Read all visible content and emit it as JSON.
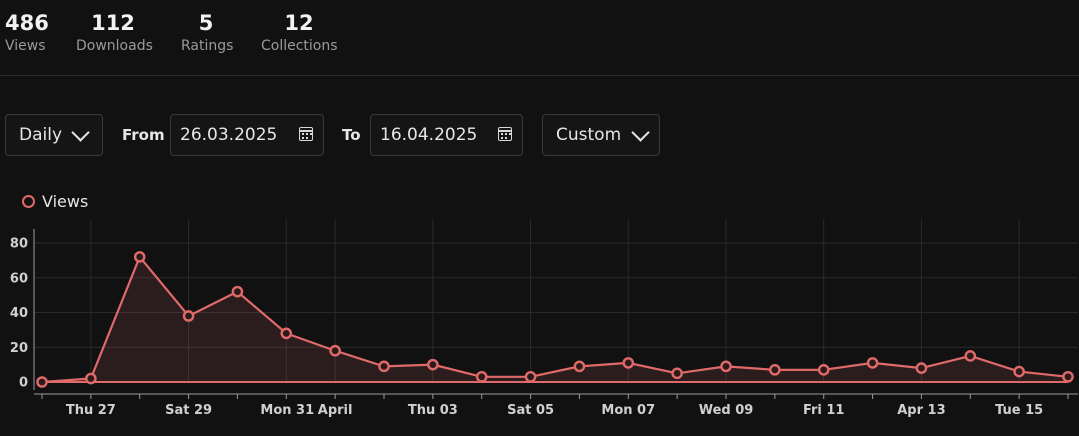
{
  "stats": [
    {
      "value": "486",
      "label": "Views"
    },
    {
      "value": "112",
      "label": "Downloads"
    },
    {
      "value": "5",
      "label": "Ratings"
    },
    {
      "value": "12",
      "label": "Collections"
    }
  ],
  "controls": {
    "interval": "Daily",
    "from_label": "From",
    "from_value": "26.03.2025",
    "to_label": "To",
    "to_value": "16.04.2025",
    "range": "Custom"
  },
  "icons": {
    "dropdown": "chevron-down-icon",
    "date": "calendar-icon",
    "legend": "circle-marker-icon"
  },
  "colors": {
    "series": "#e06a6a",
    "background": "#111112",
    "grid": "#2a2a2a"
  },
  "chart_data": {
    "type": "line",
    "legend": "top-left",
    "grid": true,
    "x": [
      "2025-03-26",
      "2025-03-27",
      "2025-03-28",
      "2025-03-29",
      "2025-03-30",
      "2025-03-31",
      "2025-04-01",
      "2025-04-02",
      "2025-04-03",
      "2025-04-04",
      "2025-04-05",
      "2025-04-06",
      "2025-04-07",
      "2025-04-08",
      "2025-04-09",
      "2025-04-10",
      "2025-04-11",
      "2025-04-12",
      "2025-04-13",
      "2025-04-14",
      "2025-04-15",
      "2025-04-16"
    ],
    "series": [
      {
        "name": "Views",
        "values": [
          0,
          2,
          72,
          38,
          52,
          28,
          18,
          9,
          10,
          3,
          3,
          9,
          11,
          5,
          9,
          7,
          7,
          11,
          8,
          15,
          6,
          3
        ]
      }
    ],
    "xticks": [
      "Thu 27",
      "Sat 29",
      "Mon 31",
      "April",
      "Thu 03",
      "Sat 05",
      "Mon 07",
      "Wed 09",
      "Fri 11",
      "Apr 13",
      "Tue 15"
    ],
    "ylim": [
      0,
      90
    ],
    "yticks": [
      "0",
      "20",
      "40",
      "60",
      "80"
    ]
  }
}
